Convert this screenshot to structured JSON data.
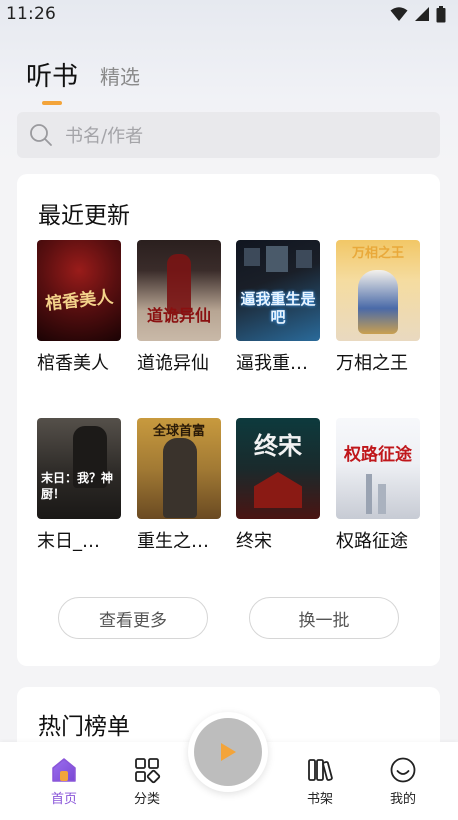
{
  "status_bar": {
    "time": "11:26"
  },
  "tabs": [
    {
      "label": "听书",
      "active": true
    },
    {
      "label": "精选",
      "active": false
    }
  ],
  "search": {
    "placeholder": "书名/作者"
  },
  "recent": {
    "title": "最近更新",
    "books": [
      {
        "title": "棺香美人",
        "cover_text": "棺香美人",
        "cover_colors": [
          "#5a0f10",
          "#1a0304"
        ]
      },
      {
        "title": "道诡异仙",
        "cover_text": "道诡异仙",
        "cover_colors": [
          "#3a2c2a",
          "#c9b9a8"
        ]
      },
      {
        "title": "逼我重…",
        "cover_text": "逼我重生是吧",
        "cover_colors": [
          "#1a1f28",
          "#2a6a9a"
        ]
      },
      {
        "title": "万相之王",
        "cover_text": "万相之王",
        "cover_colors": [
          "#f2c766",
          "#e9d9c0"
        ]
      },
      {
        "title": "末日_…",
        "cover_text": "末日：我？神厨！",
        "cover_colors": [
          "#2d2a27",
          "#7a6a58"
        ]
      },
      {
        "title": "重生之…",
        "cover_text": "全球首富",
        "cover_colors": [
          "#c89a3e",
          "#6a4a22"
        ]
      },
      {
        "title": "终宋",
        "cover_text": "终宋",
        "cover_colors": [
          "#0d3a3d",
          "#8a1a14"
        ]
      },
      {
        "title": "权路征途",
        "cover_text": "权路征途",
        "cover_colors": [
          "#eef0f4",
          "#c7cbd4"
        ]
      }
    ],
    "more_label": "查看更多",
    "refresh_label": "换一批"
  },
  "hot": {
    "title": "热门榜单"
  },
  "nav": {
    "items": [
      {
        "label": "首页",
        "icon": "home-icon",
        "active": true
      },
      {
        "label": "分类",
        "icon": "category-icon",
        "active": false
      },
      {
        "label": "书架",
        "icon": "bookshelf-icon",
        "active": false
      },
      {
        "label": "我的",
        "icon": "profile-icon",
        "active": false
      }
    ],
    "accent": "#8a56d9"
  },
  "colors": {
    "tab_underline": "#f3a43a",
    "play_icon": "#f3a43a"
  }
}
